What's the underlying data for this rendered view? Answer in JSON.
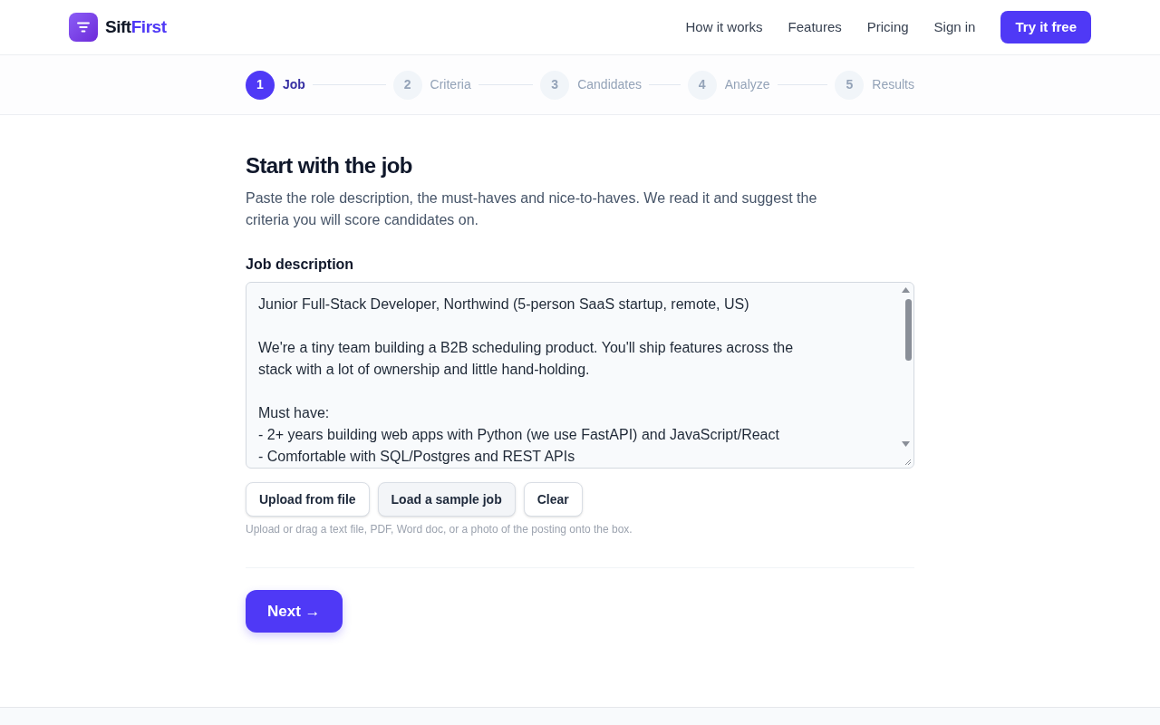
{
  "header": {
    "brand": {
      "name": "Sift",
      "accent": "First"
    },
    "nav": [
      "How it works",
      "Features",
      "Pricing",
      "Sign in"
    ],
    "cta": "Try it free"
  },
  "steps": [
    {
      "number": "1",
      "label": "Job",
      "selected": true
    },
    {
      "number": "2",
      "label": "Criteria",
      "selected": false
    },
    {
      "number": "3",
      "label": "Candidates",
      "selected": false
    },
    {
      "number": "4",
      "label": "Analyze",
      "selected": false
    },
    {
      "number": "5",
      "label": "Results",
      "selected": false
    }
  ],
  "page": {
    "title": "Start with the job",
    "subtitle": "Paste the role description, the must-haves and nice-to-haves. We read it and suggest the criteria you will score candidates on."
  },
  "job_description": {
    "label": "Job description",
    "value": "Junior Full-Stack Developer, Northwind (5-person SaaS startup, remote, US)\n\nWe're a tiny team building a B2B scheduling product. You'll ship features across the\nstack with a lot of ownership and little hand-holding.\n\nMust have:\n- 2+ years building web apps with Python (we use FastAPI) and JavaScript/React\n- Comfortable with SQL/Postgres and REST APIs"
  },
  "buttons": [
    {
      "label": "Upload from file",
      "highlighted": false
    },
    {
      "label": "Load a sample job",
      "highlighted": true
    },
    {
      "label": "Clear",
      "highlighted": false
    }
  ],
  "hint": "Upload or drag a text file, PDF, Word doc, or a photo of the posting onto the box.",
  "next_button": "Next →"
}
